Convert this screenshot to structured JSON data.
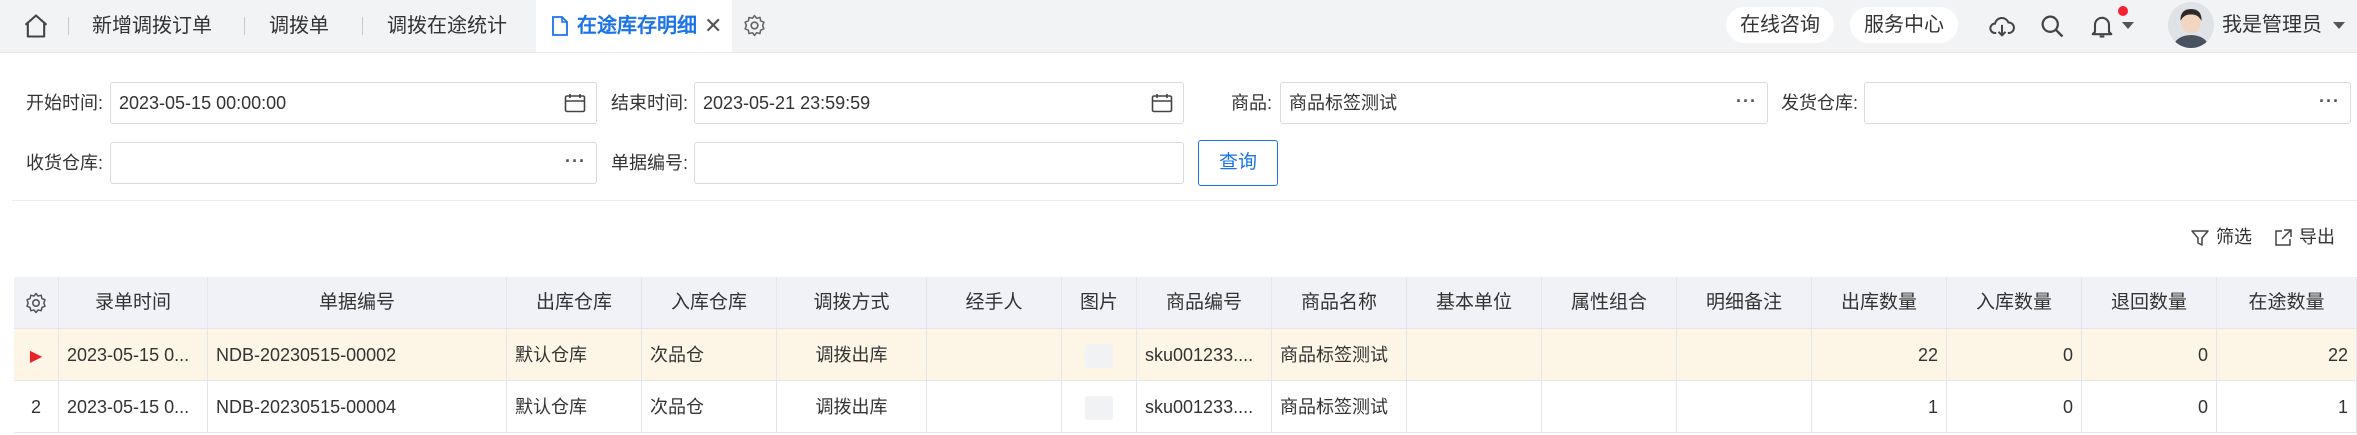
{
  "tabs": [
    {
      "label": "新增调拨订单"
    },
    {
      "label": "调拨单"
    },
    {
      "label": "调拨在途统计"
    },
    {
      "label": "在途库存明细",
      "active": true
    }
  ],
  "header": {
    "online_consult": "在线咨询",
    "service_center": "服务中心",
    "user_name": "我是管理员"
  },
  "filters": {
    "start_label": "开始时间:",
    "start_value": "2023-05-15 00:00:00",
    "end_label": "结束时间:",
    "end_value": "2023-05-21 23:59:59",
    "goods_label": "商品:",
    "goods_value": "商品标签测试",
    "from_wh_label": "发货仓库:",
    "from_wh_value": "",
    "to_wh_label": "收货仓库:",
    "to_wh_value": "",
    "doc_no_label": "单据编号:",
    "doc_no_value": "",
    "query_label": "查询"
  },
  "toolbar": {
    "filter_label": "筛选",
    "export_label": "导出"
  },
  "table": {
    "columns": [
      "录单时间",
      "单据编号",
      "出库仓库",
      "入库仓库",
      "调拨方式",
      "经手人",
      "图片",
      "商品编号",
      "商品名称",
      "基本单位",
      "属性组合",
      "明细备注",
      "出库数量",
      "入库数量",
      "退回数量",
      "在途数量"
    ],
    "rows": [
      {
        "index": "",
        "selected": true,
        "cells": [
          "2023-05-15 0...",
          "NDB-20230515-00002",
          "默认仓库",
          "次品仓",
          "调拨出库",
          "",
          "",
          "sku001233....",
          "商品标签测试",
          "",
          "",
          "",
          "22",
          "0",
          "0",
          "22"
        ]
      },
      {
        "index": "2",
        "selected": false,
        "cells": [
          "2023-05-15 0...",
          "NDB-20230515-00004",
          "默认仓库",
          "次品仓",
          "调拨出库",
          "",
          "",
          "sku001233....",
          "商品标签测试",
          "",
          "",
          "",
          "1",
          "0",
          "0",
          "1"
        ]
      }
    ]
  },
  "colors": {
    "accent": "#1a73e8",
    "selected_row": "#fdf6e6",
    "header_row": "#f0f2f7",
    "notification_dot": "#f5222d"
  }
}
